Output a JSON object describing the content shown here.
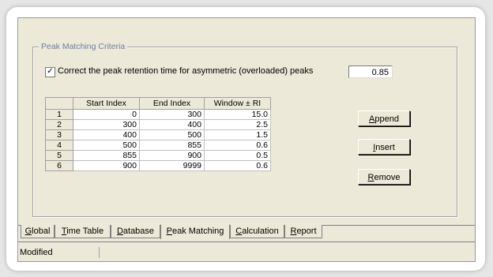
{
  "group_title": "Peak Matching Criteria",
  "checkbox": {
    "checked": true,
    "mark": "✓",
    "label": "Correct the peak retention time for asymmetric (overloaded) peaks"
  },
  "factor_value": "0.85",
  "table": {
    "headers": [
      "",
      "Start Index",
      "End Index",
      "Window ± RI"
    ],
    "rows": [
      [
        "1",
        "0",
        "300",
        "15.0"
      ],
      [
        "2",
        "300",
        "400",
        "2.5"
      ],
      [
        "3",
        "400",
        "500",
        "1.5"
      ],
      [
        "4",
        "500",
        "855",
        "0.6"
      ],
      [
        "5",
        "855",
        "900",
        "0.5"
      ],
      [
        "6",
        "900",
        "9999",
        "0.6"
      ]
    ]
  },
  "buttons": {
    "append": {
      "first": "A",
      "rest": "ppend"
    },
    "insert": {
      "first": "I",
      "rest": "nsert"
    },
    "remove": {
      "first": "R",
      "rest": "emove"
    }
  },
  "tabs": [
    {
      "first": "G",
      "rest": "lobal"
    },
    {
      "first": "T",
      "rest": "ime Table"
    },
    {
      "first": "D",
      "rest": "atabase"
    },
    {
      "first": "P",
      "rest": "eak Matching"
    },
    {
      "first": "C",
      "rest": "alculation"
    },
    {
      "first": "R",
      "rest": "eport"
    }
  ],
  "active_tab": "Peak Matching",
  "status_text": "Modified"
}
